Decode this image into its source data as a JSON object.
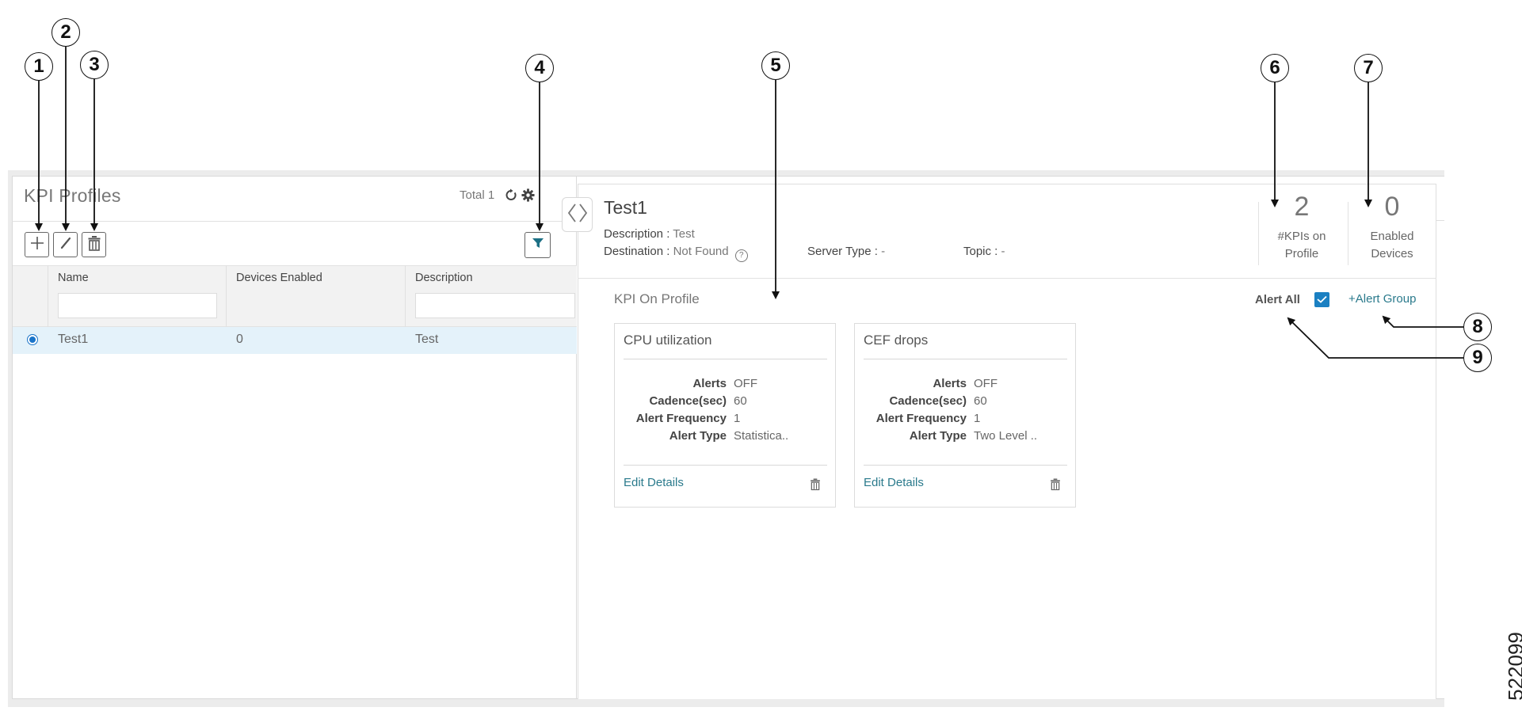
{
  "left_panel": {
    "title": "KPI Profiles",
    "total_label": "Total 1",
    "toolbar": {
      "add": "add-icon",
      "edit": "edit-icon",
      "delete": "delete-icon",
      "filter": "filter-icon"
    },
    "table": {
      "columns": [
        "Name",
        "Devices Enabled",
        "Description"
      ],
      "filters": {
        "name": "",
        "description": ""
      },
      "rows": [
        {
          "selected": true,
          "name": "Test1",
          "devices_enabled": "0",
          "description": "Test"
        }
      ]
    }
  },
  "detail": {
    "title": "Test1",
    "description_label": "Description :",
    "description_value": "Test",
    "destination_label": "Destination :",
    "destination_value": "Not Found",
    "help_glyph": "?",
    "server_type_label": "Server Type :",
    "server_type_value": "-",
    "topic_label": "Topic :",
    "topic_value": "-",
    "stats": [
      {
        "value": "2",
        "label_line1": "#KPIs on",
        "label_line2": "Profile"
      },
      {
        "value": "0",
        "label_line1": "Enabled",
        "label_line2": "Devices"
      }
    ],
    "kpi_heading": "KPI On Profile",
    "alert_all_label": "Alert All",
    "alert_all_checked": true,
    "alert_group_label": "+Alert Group",
    "accent_color": "#1b80c2",
    "link_color": "#2a7a8c",
    "kpis": [
      {
        "title": "CPU utilization",
        "fields": [
          {
            "label": "Alerts",
            "value": "OFF"
          },
          {
            "label": "Cadence(sec)",
            "value": "60"
          },
          {
            "label": "Alert Frequency",
            "value": "1"
          },
          {
            "label": "Alert Type",
            "value": "Statistica.."
          }
        ],
        "edit_label": "Edit Details"
      },
      {
        "title": "CEF drops",
        "fields": [
          {
            "label": "Alerts",
            "value": "OFF"
          },
          {
            "label": "Cadence(sec)",
            "value": "60"
          },
          {
            "label": "Alert Frequency",
            "value": "1"
          },
          {
            "label": "Alert Type",
            "value": "Two Level .."
          }
        ],
        "edit_label": "Edit Details"
      }
    ]
  },
  "callouts": [
    "1",
    "2",
    "3",
    "4",
    "5",
    "6",
    "7",
    "8",
    "9"
  ],
  "figure_number": "522099"
}
